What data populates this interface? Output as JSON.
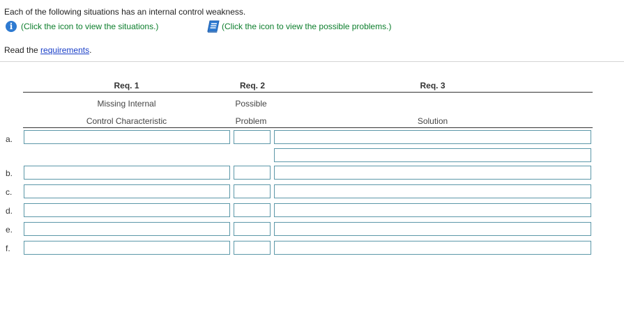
{
  "intro_text": "Each of the following situations has an internal control weakness.",
  "situations_link": "(Click the icon to view the situations.)",
  "problems_link": "(Click the icon to view the possible problems.)",
  "read_prefix": "Read the ",
  "requirements_link": "requirements",
  "read_suffix": ".",
  "table": {
    "req1": "Req. 1",
    "req2": "Req. 2",
    "req3": "Req. 3",
    "col1_line1": "Missing Internal",
    "col1_line2": "Control Characteristic",
    "col2_line1": "Possible",
    "col2_line2": "Problem",
    "col3": "Solution",
    "rows": [
      "a.",
      "b.",
      "c.",
      "d.",
      "e.",
      "f."
    ]
  },
  "colors": {
    "accent_green": "#0c7e2c",
    "link_blue": "#1a3fc8",
    "info_blue": "#2e7ad1",
    "field_border": "#5b97a8"
  },
  "icons": {
    "situations": "info-icon",
    "problems": "book-icon"
  }
}
